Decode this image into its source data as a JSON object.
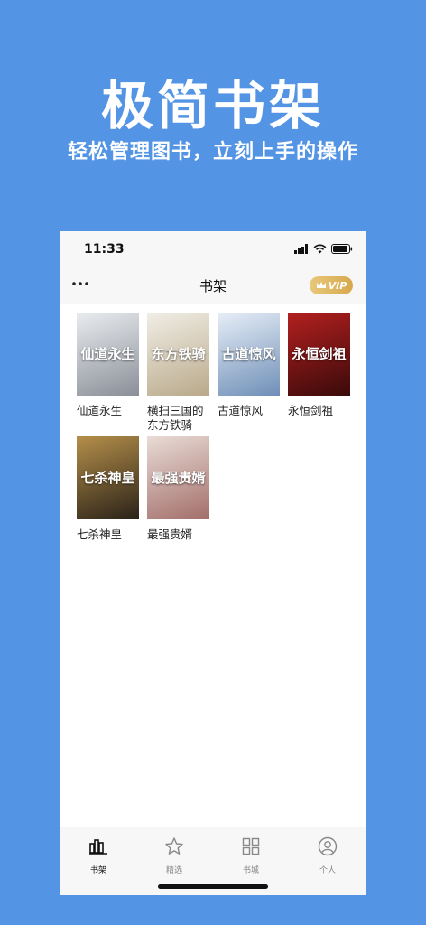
{
  "promo": {
    "title": "极简书架",
    "subtitle": "轻松管理图书，立刻上手的操作"
  },
  "status": {
    "time": "11:33"
  },
  "nav": {
    "title": "书架",
    "more_icon": "more-dots-icon",
    "vip_label": "VIP"
  },
  "books": [
    {
      "title": "仙道永生",
      "cover_text": "仙道永生",
      "colors": [
        "#e9ecef",
        "#8a8f98"
      ]
    },
    {
      "title": "横扫三国的东方铁骑",
      "cover_text": "东方铁骑",
      "colors": [
        "#f1eee6",
        "#b9a98a"
      ]
    },
    {
      "title": "古道惊风",
      "cover_text": "古道惊风",
      "colors": [
        "#e7eef7",
        "#6f8fb7"
      ]
    },
    {
      "title": "永恒剑祖",
      "cover_text": "永恒剑祖",
      "colors": [
        "#b3201f",
        "#3a0a0a"
      ]
    },
    {
      "title": "七杀神皇",
      "cover_text": "七杀神皇",
      "colors": [
        "#b58f4a",
        "#2a2218"
      ]
    },
    {
      "title": "最强贵婿",
      "cover_text": "最强贵婿",
      "colors": [
        "#e9dcd6",
        "#a36e6a"
      ]
    }
  ],
  "tabs": [
    {
      "label": "书架",
      "icon": "bookshelf-icon",
      "active": true
    },
    {
      "label": "精选",
      "icon": "star-icon",
      "active": false
    },
    {
      "label": "书城",
      "icon": "grid-icon",
      "active": false
    },
    {
      "label": "个人",
      "icon": "person-icon",
      "active": false
    }
  ],
  "colors": {
    "background": "#5394e4",
    "vip": "#d7a94e",
    "tab_active": "#111111",
    "tab_inactive": "#888888"
  }
}
